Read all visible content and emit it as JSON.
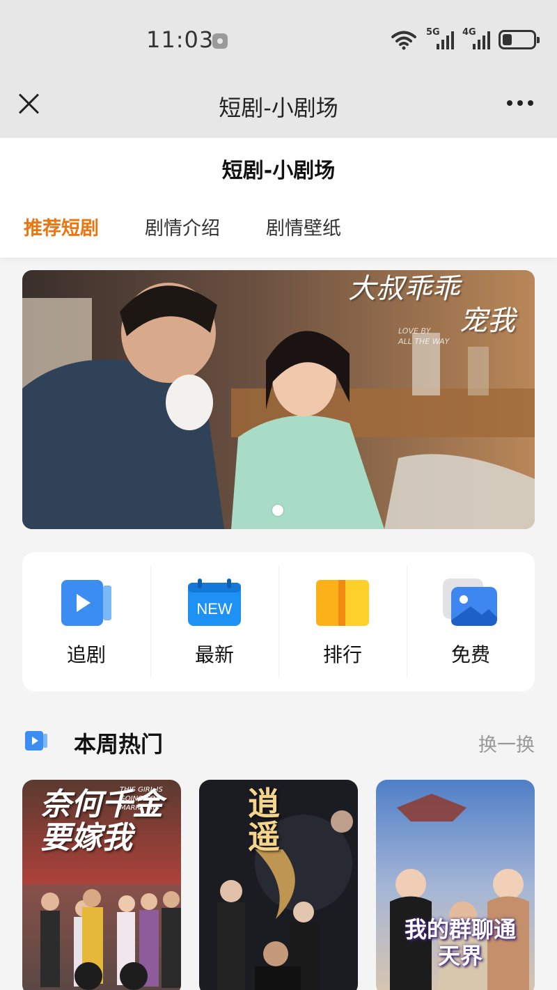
{
  "status_bar": {
    "time": "11:03",
    "network_1": "5G",
    "network_2": "4G",
    "battery_level": 0.3
  },
  "title_bar": {
    "title": "短剧-小剧场",
    "close_icon": "close-icon",
    "more_icon": "more-icon"
  },
  "page": {
    "title": "短剧-小剧场",
    "tabs": [
      {
        "label": "推荐短剧",
        "active": true
      },
      {
        "label": "剧情介绍",
        "active": false
      },
      {
        "label": "剧情壁纸",
        "active": false
      }
    ],
    "accent_color": "#ea7612"
  },
  "banner": {
    "title_line1": "大叔乖乖",
    "title_line2": "宠我",
    "subtitle_line1": "LOVE BY",
    "subtitle_line2": "ALL THE WAY",
    "active_dot": 1
  },
  "quick_menu": [
    {
      "label": "追剧",
      "icon": "video-play-icon"
    },
    {
      "label": "最新",
      "icon": "new-calendar-icon",
      "badge": "NEW"
    },
    {
      "label": "排行",
      "icon": "ranking-icon"
    },
    {
      "label": "免费",
      "icon": "image-gallery-icon"
    }
  ],
  "weekly_hot": {
    "title": "本周热门",
    "refresh_label": "换一换",
    "items": [
      {
        "title": "奈何千金要嫁我",
        "poster_sub": "THIS GIRL IS GOING TO MARRY ME"
      },
      {
        "title": "逍遥",
        "poster_sub": ""
      },
      {
        "title": "我的群聊通天界",
        "poster_sub": ""
      }
    ]
  }
}
